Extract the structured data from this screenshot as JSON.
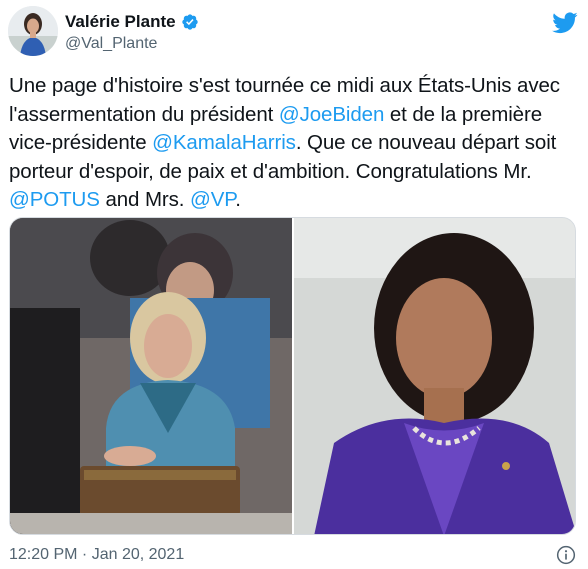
{
  "author": {
    "display_name": "Valérie Plante",
    "handle": "@Val_Plante",
    "verified": true
  },
  "tweet": {
    "segments": [
      {
        "text": "Une page d'histoire s'est tournée ce midi aux États-Unis avec l'assermentation du président ",
        "type": "text"
      },
      {
        "text": "@JoeBiden",
        "type": "mention"
      },
      {
        "text": " et de la première vice-présidente ",
        "type": "text"
      },
      {
        "text": "@KamalaHarris",
        "type": "mention"
      },
      {
        "text": ". Que ce nouveau départ soit porteur d'espoir, de paix et d'ambition. Congratulations Mr. ",
        "type": "text"
      },
      {
        "text": "@POTUS",
        "type": "mention"
      },
      {
        "text": " and Mrs. ",
        "type": "text"
      },
      {
        "text": "@VP",
        "type": "mention"
      },
      {
        "text": ".",
        "type": "text"
      }
    ],
    "timestamp": "12:20 PM · Jan 20, 2021"
  },
  "icons": {
    "verified": "verified-badge-icon",
    "brand": "twitter-bird-icon",
    "info": "info-icon"
  },
  "colors": {
    "accent": "#1d9bf0",
    "text": "#0f1419",
    "secondary": "#536471"
  }
}
